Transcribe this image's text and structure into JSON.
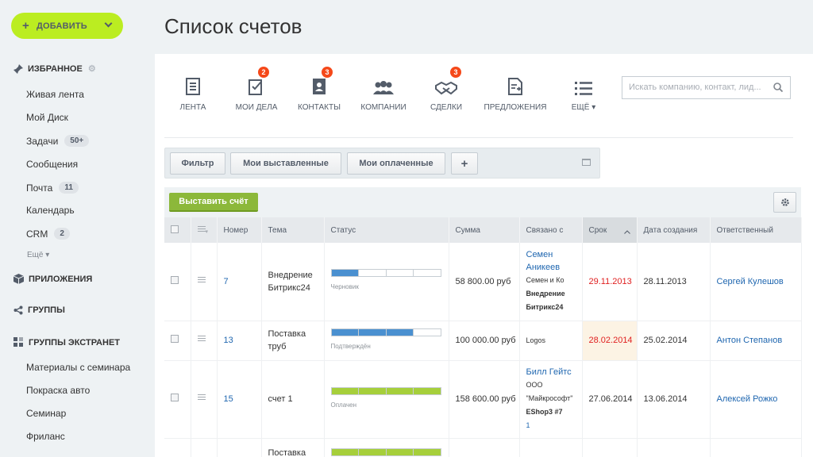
{
  "sidebar": {
    "add_label": "ДОБАВИТЬ",
    "favorites_label": "ИЗБРАННОЕ",
    "items": [
      {
        "label": "Живая лента"
      },
      {
        "label": "Мой Диск"
      },
      {
        "label": "Задачи",
        "badge": "50+"
      },
      {
        "label": "Сообщения"
      },
      {
        "label": "Почта",
        "badge": "11"
      },
      {
        "label": "Календарь"
      },
      {
        "label": "CRM",
        "badge": "2"
      }
    ],
    "more_label": "Ещё ▾",
    "apps_label": "ПРИЛОЖЕНИЯ",
    "groups_label": "ГРУППЫ",
    "extranet_label": "ГРУППЫ ЭКСТРАНЕТ",
    "extranet_items": [
      {
        "label": "Материалы с семинара"
      },
      {
        "label": "Покраска авто"
      },
      {
        "label": "Семинар"
      },
      {
        "label": "Фриланс"
      }
    ]
  },
  "page_title": "Список счетов",
  "toolbar": {
    "items": [
      {
        "label": "ЛЕНТА",
        "icon": "feed-icon"
      },
      {
        "label": "МОИ ДЕЛА",
        "icon": "tasks-icon",
        "counter": "2"
      },
      {
        "label": "КОНТАКТЫ",
        "icon": "contacts-icon",
        "counter": "3"
      },
      {
        "label": "КОМПАНИИ",
        "icon": "companies-icon"
      },
      {
        "label": "СДЕЛКИ",
        "icon": "deals-icon",
        "counter": "3"
      },
      {
        "label": "ПРЕДЛОЖЕНИЯ",
        "icon": "quotes-icon"
      },
      {
        "label": "ЕЩЁ ▾",
        "icon": "more-list-icon"
      }
    ],
    "search_placeholder": "Искать компанию, контакт, лид..."
  },
  "filters": {
    "filter_label": "Фильтр",
    "issued_label": "Мои выставленные",
    "paid_label": "Мои оплаченные",
    "add_label": "+"
  },
  "issue_button_label": "Выставить счёт",
  "table": {
    "headers": {
      "number": "Номер",
      "topic": "Тема",
      "status": "Статус",
      "sum": "Сумма",
      "related": "Связано с",
      "due": "Срок",
      "created": "Дата создания",
      "responsible": "Ответственный"
    },
    "rows": [
      {
        "number": "7",
        "topic": "Внедрение Битрикс24",
        "status": "Черновик",
        "status_fill": 1,
        "sum": "58 800.00 руб",
        "related_contact": "Семен Аникеев",
        "related_company": "Семен и Ко",
        "related_deal": "Внедрение Битрикс24",
        "due": "29.11.2013",
        "created": "28.11.2013",
        "responsible": "Сергей Кулешов"
      },
      {
        "number": "13",
        "topic": "Поставка труб",
        "status": "Подтверждён",
        "status_fill": 3,
        "sum": "100 000.00 руб",
        "related_company": "Logos",
        "due": "28.02.2014",
        "created": "25.02.2014",
        "responsible": "Антон Степанов"
      },
      {
        "number": "15",
        "topic": "счет 1",
        "status": "Оплачен",
        "status_fill": 4,
        "sum": "158 600.00 руб",
        "related_contact": "Билл Гейтс",
        "related_company": "ООО \"Майкрософт\"",
        "related_deal": "EShop3 #7",
        "related_extra": "1",
        "due": "27.06.2014",
        "created": "13.06.2014",
        "responsible": "Алексей Рожко"
      },
      {
        "topic": "Поставка"
      }
    ]
  },
  "colors": {
    "accent_green": "#bbed21",
    "status_blue": "#4a90d0",
    "status_green": "#a6cf3b",
    "link": "#2067b0",
    "overdue": "#e02020",
    "counter": "#f54819"
  }
}
